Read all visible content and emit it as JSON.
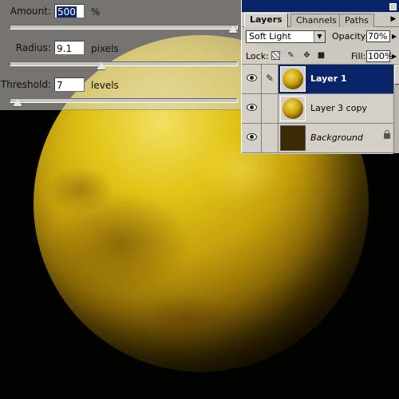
{
  "filter_dialog": {
    "amount": {
      "label": "Amount:",
      "value": "500",
      "unit": "%",
      "slider_fraction": 1.0
    },
    "radius": {
      "label": "Radius:",
      "value": "9.1",
      "unit": "pixels",
      "slider_fraction": 0.4
    },
    "threshold": {
      "label": "Threshold:",
      "value": "7",
      "unit": "levels",
      "slider_fraction": 0.03
    }
  },
  "layers_panel": {
    "tabs": [
      {
        "label": "Layers",
        "active": true
      },
      {
        "label": "Channels",
        "active": false
      },
      {
        "label": "Paths",
        "active": false
      }
    ],
    "menu_icon": "triangle-menu-icon",
    "blend_mode": "Soft Light",
    "opacity_label": "Opacity:",
    "opacity_value": "70%",
    "lock_label": "Lock:",
    "fill_label": "Fill:",
    "fill_value": "100%",
    "layers": [
      {
        "name": "Layer 1",
        "selected": true,
        "visible": true,
        "thumbnail": "planet"
      },
      {
        "name": "Layer 3 copy",
        "selected": false,
        "visible": true,
        "thumbnail": "planet"
      },
      {
        "name": "Background",
        "selected": false,
        "visible": true,
        "thumbnail": "dark",
        "locked": true
      }
    ]
  },
  "colors": {
    "selection_blue": "#0a246a",
    "panel_gray": "#d4d0c8",
    "planet_yellow": "#e2c417"
  }
}
